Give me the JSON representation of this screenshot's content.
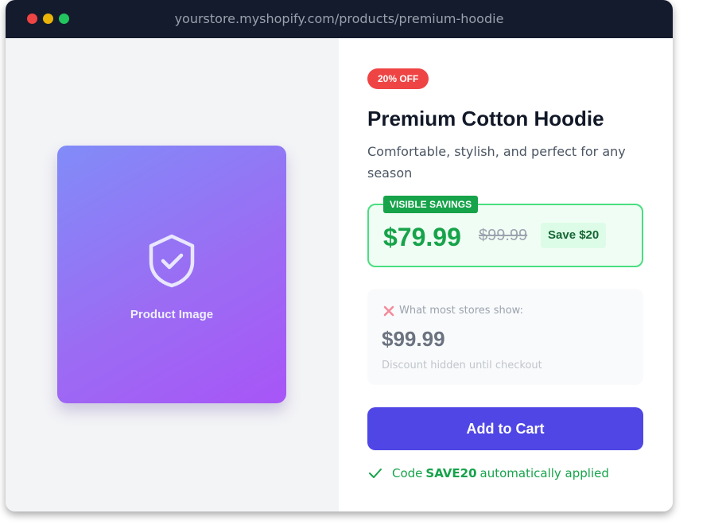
{
  "browser": {
    "url": "yourstore.myshopify.com/products/premium-hoodie"
  },
  "product_image": {
    "icon": "shield-check-icon",
    "label": "Product Image"
  },
  "product": {
    "discount_badge": "20% OFF",
    "title": "Premium Cotton Hoodie",
    "subtitle": "Comfortable, stylish, and perfect for any season"
  },
  "savings": {
    "tag": "VISIBLE SAVINGS",
    "sale_price": "$79.99",
    "original_price": "$99.99",
    "save_label": "Save $20"
  },
  "comparison": {
    "icon": "x-icon",
    "label": "What most stores show:",
    "price": "$99.99",
    "note": "Discount hidden until checkout"
  },
  "cart": {
    "button_label": "Add to Cart"
  },
  "coupon": {
    "icon": "check-icon",
    "prefix": "Code",
    "code": "SAVE20",
    "suffix": "automatically applied"
  },
  "colors": {
    "accent": "#4f46e5",
    "success": "#16a34a",
    "danger": "#ef4444",
    "titlebar": "#141b2d"
  }
}
